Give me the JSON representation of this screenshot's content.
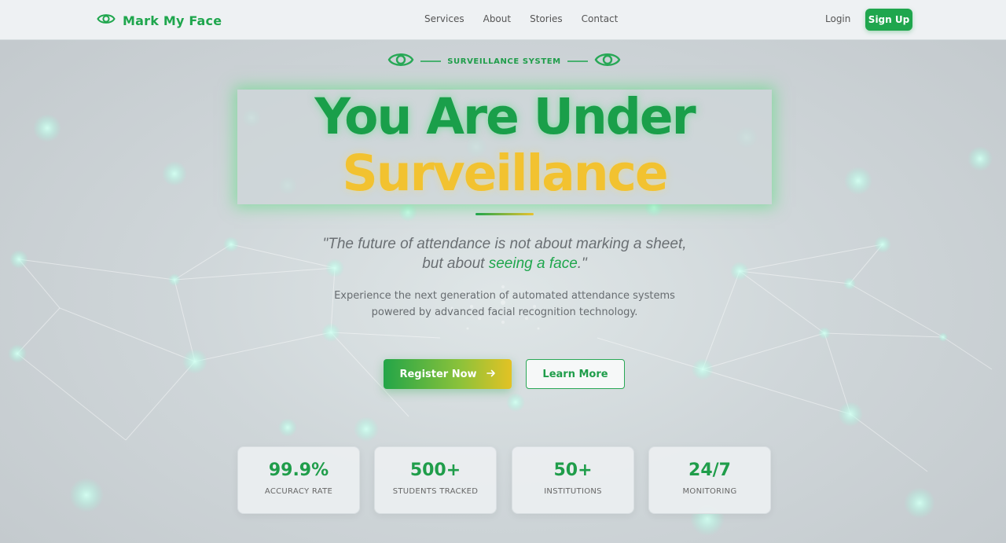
{
  "brand": {
    "name": "Mark My Face",
    "accent": "#1fa64d",
    "highlight": "#f2c230",
    "icon": "eye-icon"
  },
  "nav": {
    "links": [
      "Services",
      "About",
      "Stories",
      "Contact"
    ],
    "login": "Login",
    "signup": "Sign Up"
  },
  "hero": {
    "badge": "SURVEILLANCE SYSTEM",
    "title_line1": "You Are Under",
    "title_line2": "Surveillance",
    "quote_part1": "\"The future of attendance is not about marking a sheet,",
    "quote_part2": "but about ",
    "quote_highlight": "seeing a face",
    "quote_end": ".\"",
    "desc_line1": "Experience the next generation of automated attendance systems",
    "desc_line2": "powered by advanced facial recognition technology.",
    "register_label": "Register Now",
    "learn_label": "Learn More"
  },
  "stats": [
    {
      "value": "99.9%",
      "label": "ACCURACY RATE"
    },
    {
      "value": "500+",
      "label": "STUDENTS TRACKED"
    },
    {
      "value": "50+",
      "label": "INSTITUTIONS"
    },
    {
      "value": "24/7",
      "label": "MONITORING"
    }
  ]
}
